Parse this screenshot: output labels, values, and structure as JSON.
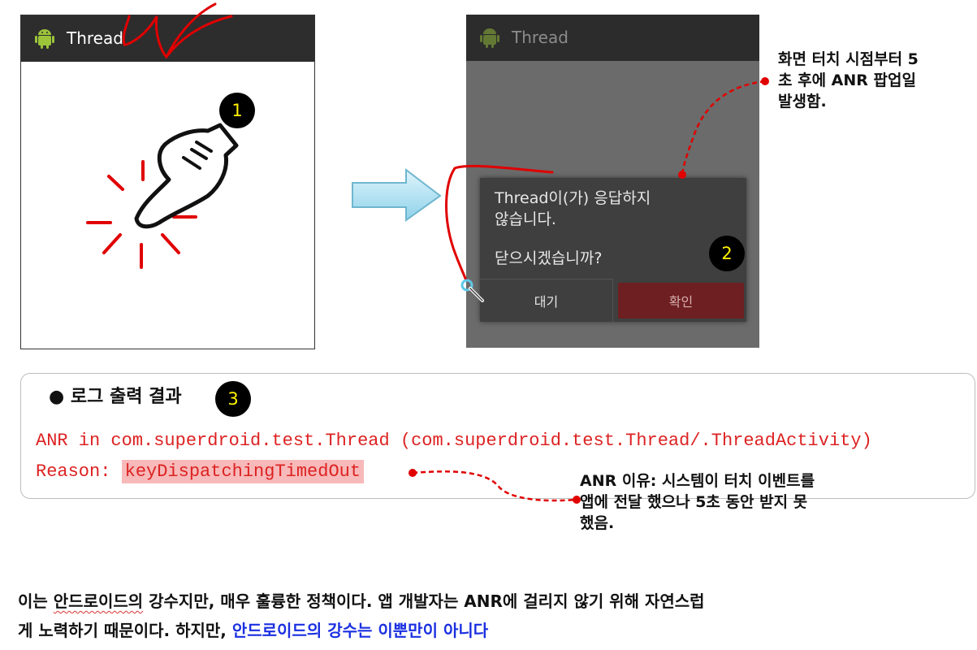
{
  "phone_left": {
    "app_title": "Thread",
    "badge": "1"
  },
  "phone_right": {
    "app_title": "Thread",
    "dialog": {
      "message_line1": "Thread이(가) 응답하지",
      "message_line2": "않습니다.",
      "question": "닫으시겠습니까?",
      "wait_label": "대기",
      "ok_label": "확인"
    },
    "badge": "2"
  },
  "note_popup": {
    "line1": "화면 터치 시점부터 5",
    "line2": "초 후에 ANR 팝업일",
    "line3": "발생함."
  },
  "log": {
    "heading": "● 로그 출력 결과",
    "badge": "3",
    "line1": "ANR in com.superdroid.test.Thread (com.superdroid.test.Thread/.ThreadActivity)",
    "reason_label": "Reason: ",
    "reason_value": "keyDispatchingTimedOut"
  },
  "note_reason": {
    "line1": "ANR 이유: 시스템이 터치 이벤트를",
    "line2": "앱에 전달 했으나 5초 동안 받지 못",
    "line3": "했음."
  },
  "paragraph": {
    "part1": "이는 ",
    "part2": "안드로이드의",
    "part3": " 강수지만, 매우 훌륭한 정책이다.  앱 개발자는 ANR에 걸리지 않기 위해 자연스럽",
    "part4": "게 노력하기 때문이다. 하지만, ",
    "part5_blue": "안드로이드의 강수는 이뿐만이 아니다"
  },
  "colors": {
    "annotation_red": "#e00000",
    "link_blue": "#1a2fe0",
    "log_red": "#dd2222"
  }
}
